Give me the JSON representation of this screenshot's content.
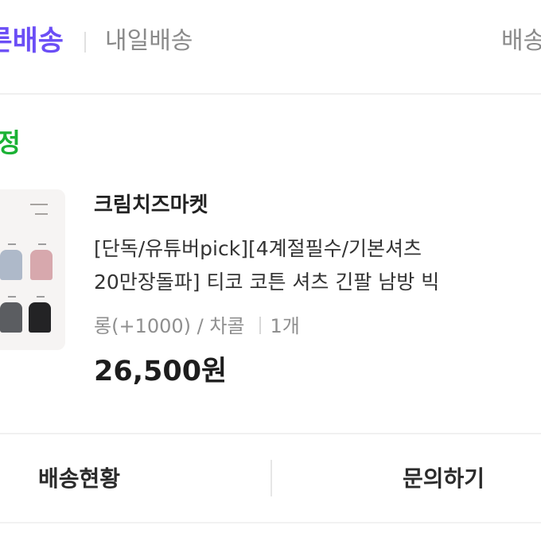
{
  "tabs": {
    "active_label": "빠른배송",
    "next_label": "내일배송",
    "right_label": "배송"
  },
  "order": {
    "status": "배송예정",
    "seller": "크림치즈마켓",
    "title_line1": "[단독/유튜버pick][4계절필수/기본셔츠",
    "title_line2": "20만장돌파] 티코 코튼 셔츠 긴팔 남방 빅",
    "option": "롱(+1000) / 차콜",
    "quantity": "1개",
    "price": "26,500원"
  },
  "actions": {
    "delivery_status": "배송현황",
    "inquiry": "문의하기"
  },
  "colors": {
    "accent_purple": "#6b4ef6",
    "status_green": "#1bb235"
  }
}
